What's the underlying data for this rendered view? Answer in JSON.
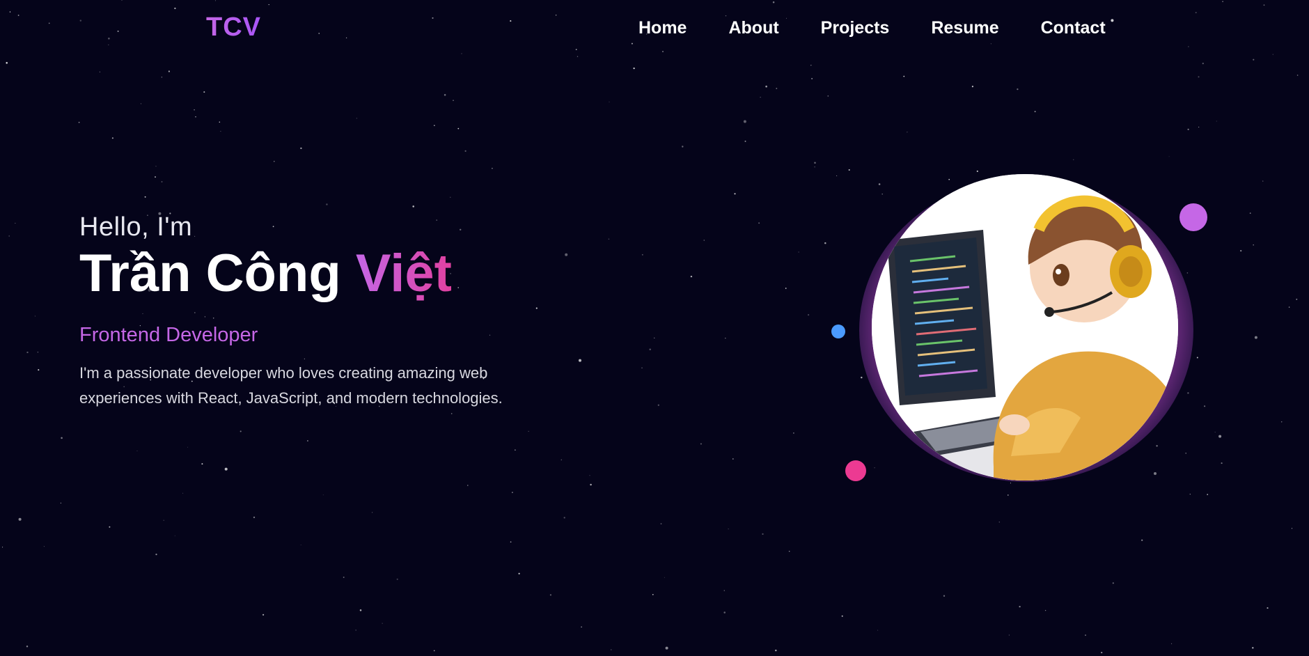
{
  "nav": {
    "logo": "TCV",
    "links": [
      {
        "label": "Home"
      },
      {
        "label": "About"
      },
      {
        "label": "Projects"
      },
      {
        "label": "Resume"
      },
      {
        "label": "Contact"
      }
    ]
  },
  "hero": {
    "greeting": "Hello, I'm",
    "name_first": "Trần Công",
    "name_accent": "Việt",
    "role": "Frontend Developer",
    "bio": "I'm a passionate developer who loves creating amazing web experiences with React, JavaScript, and modern technologies."
  },
  "avatar": {
    "icon": "developer-avatar-illustration"
  },
  "colors": {
    "background": "#05041a",
    "accent_purple": "#c567e6",
    "accent_pink": "#ec3a92",
    "accent_blue": "#4b9bff"
  }
}
